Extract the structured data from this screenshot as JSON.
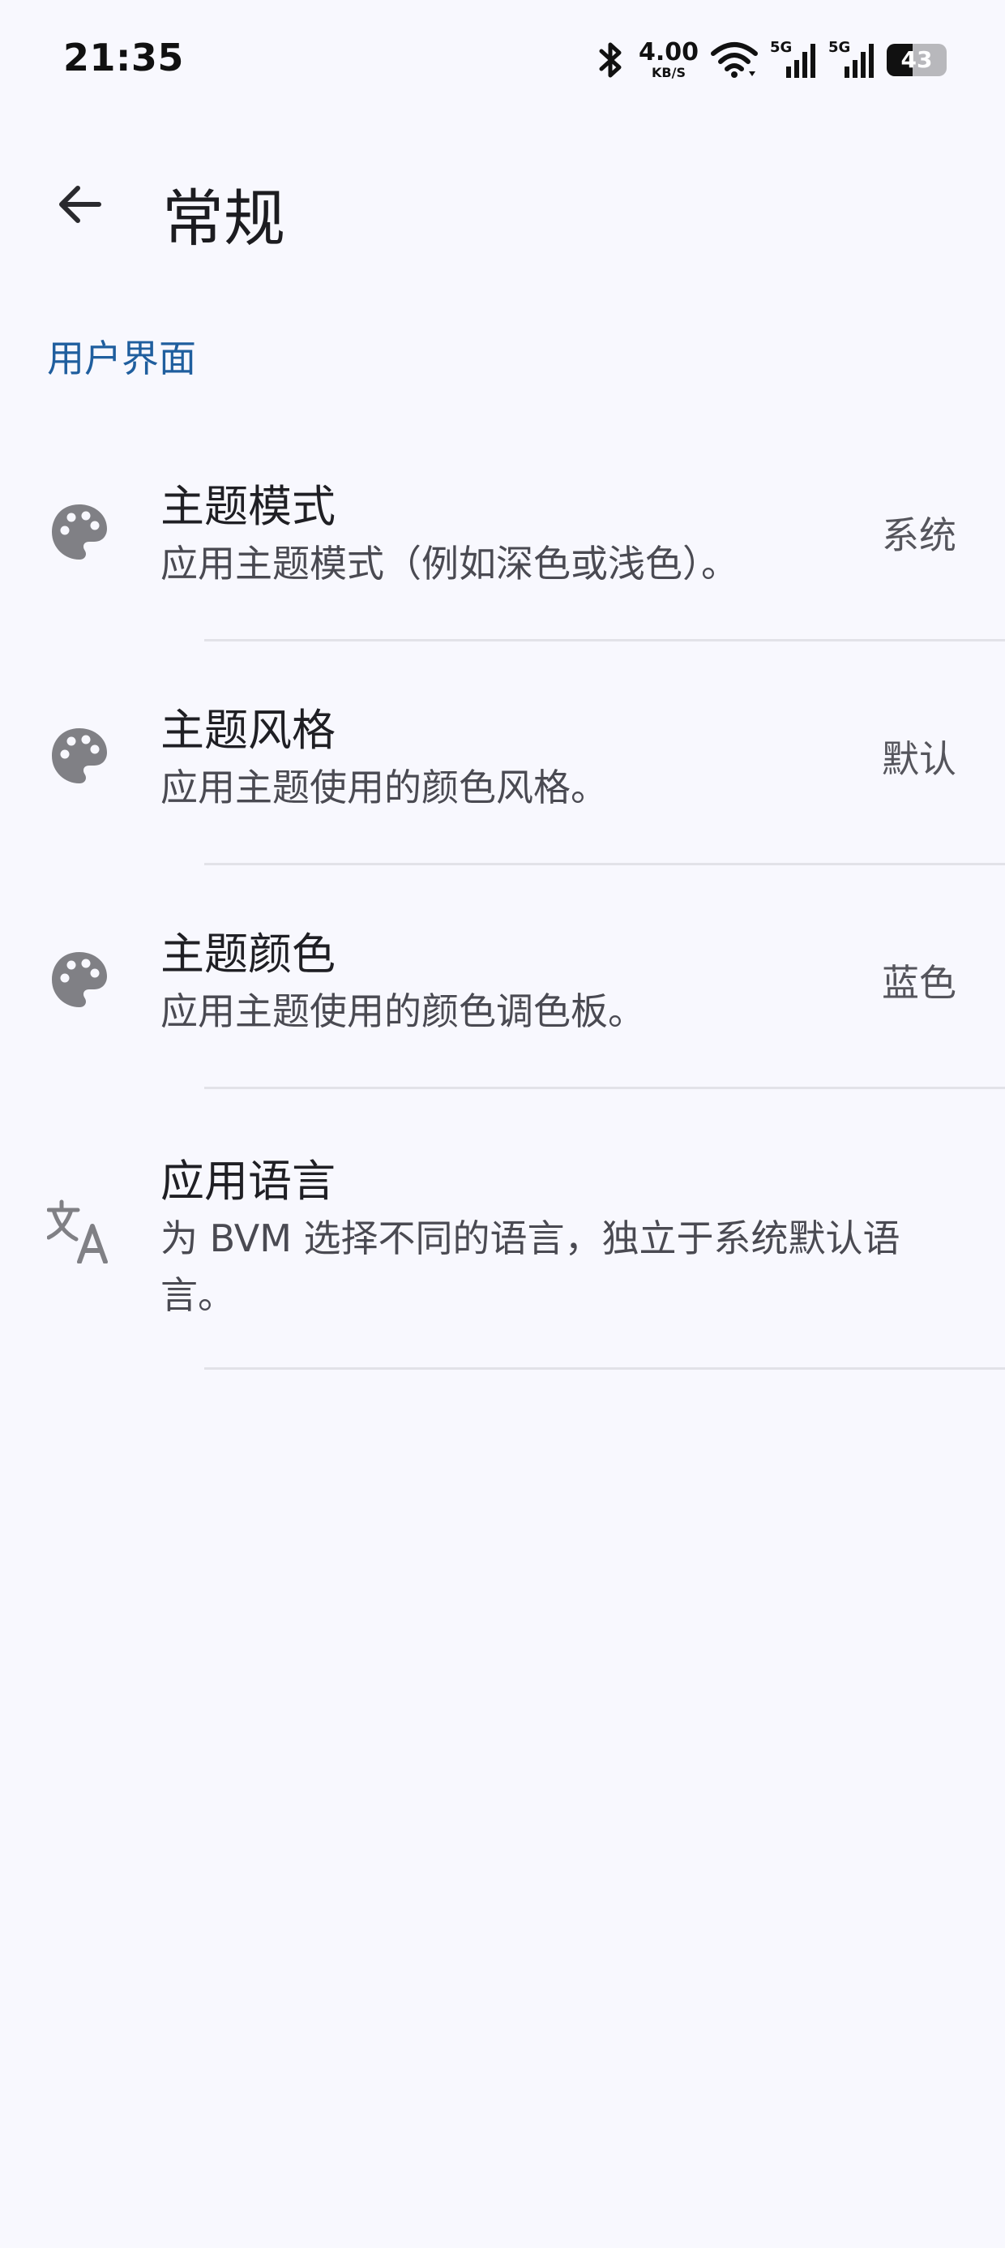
{
  "status_bar": {
    "time": "21:35",
    "net_speed_value": "4.00",
    "net_speed_unit": "KB/S",
    "signal_1_label": "5G",
    "signal_2_label": "5G",
    "battery_level": "43",
    "icons": [
      "bluetooth-icon",
      "wifi-icon",
      "signal-icon",
      "battery-icon"
    ]
  },
  "app_bar": {
    "back_icon": "arrow-back-icon",
    "title": "常规"
  },
  "section": {
    "header": "用户界面"
  },
  "settings": [
    {
      "icon": "palette-icon",
      "title": "主题模式",
      "summary": "应用主题模式（例如深色或浅色）。",
      "value": "系统"
    },
    {
      "icon": "palette-icon",
      "title": "主题风格",
      "summary": "应用主题使用的颜色风格。",
      "value": "默认"
    },
    {
      "icon": "palette-icon",
      "title": "主题颜色",
      "summary": "应用主题使用的颜色调色板。",
      "value": "蓝色"
    },
    {
      "icon": "translate-icon",
      "title": "应用语言",
      "summary": "为 BVM 选择不同的语言，独立于系统默认语言。",
      "value": ""
    }
  ],
  "colors": {
    "background": "#f8f8fe",
    "accent": "#1f5e9e",
    "icon": "#808085",
    "divider": "#e2e2e8"
  }
}
